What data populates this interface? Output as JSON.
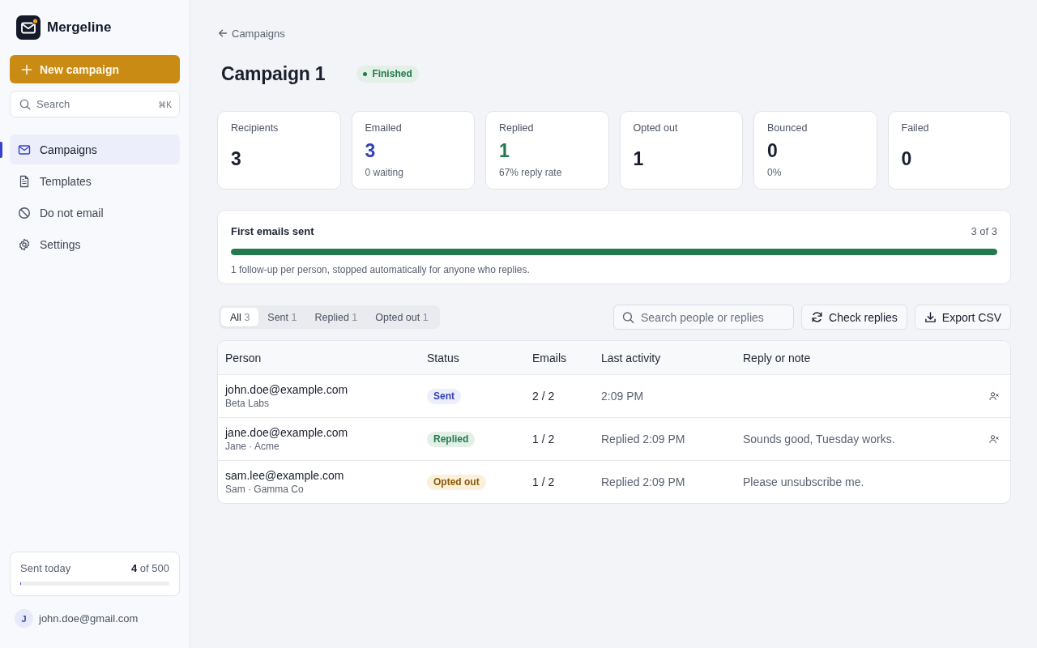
{
  "sidebar": {
    "brand": "Mergeline",
    "new_button": "New campaign",
    "search": {
      "placeholder": "Search",
      "shortcut": "⌘K"
    },
    "nav": [
      {
        "label": "Campaigns",
        "selected": true
      },
      {
        "label": "Templates",
        "selected": false
      },
      {
        "label": "Do not email",
        "selected": false
      },
      {
        "label": "Settings",
        "selected": false
      }
    ],
    "usage": {
      "label": "Sent today",
      "value": "**4** of 500",
      "level": 0.008
    },
    "user": {
      "initial": "J",
      "email": "john.doe@gmail.com"
    }
  },
  "header": {
    "back_link": "Campaigns",
    "title": "Campaign 1",
    "status": "Finished"
  },
  "stats": [
    {
      "label": "Recipients",
      "value": "3",
      "color": "#1a1f2e"
    },
    {
      "label": "Emailed",
      "value": "3",
      "note": "0 waiting",
      "color": "#3641b7"
    },
    {
      "label": "Replied",
      "value": "1",
      "note": "67% reply rate",
      "color": "#237a4c"
    },
    {
      "label": "Opted out",
      "value": "1",
      "color": "#1a1f2e"
    },
    {
      "label": "Bounced",
      "value": "0",
      "note": "0%",
      "color": "#1a1f2e"
    },
    {
      "label": "Failed",
      "value": "0",
      "color": "#1a1f2e"
    }
  ],
  "progress": {
    "title": "First emails sent",
    "count": "3 of 3",
    "level": 1,
    "note": "1 follow-up per person, stopped automatically for anyone who replies."
  },
  "filters": [
    {
      "label": "All",
      "count": "3",
      "selected": true
    },
    {
      "label": "Sent",
      "count": "1",
      "selected": false
    },
    {
      "label": "Replied",
      "count": "1",
      "selected": false
    },
    {
      "label": "Opted out",
      "count": "1",
      "selected": false
    }
  ],
  "search": {
    "placeholder": "Search people or replies"
  },
  "actions": [
    "Check replies",
    "Export CSV"
  ],
  "table": {
    "columns": [
      "Person",
      "Status",
      "Emails",
      "Last activity",
      "Reply or note"
    ],
    "rows": [
      {
        "email": "john.doe@example.com",
        "detail": "Beta Labs",
        "status": {
          "label": "Sent",
          "kind": "sent"
        },
        "emails": "2 / 2",
        "last_activity": "2:09 PM",
        "block_action": true
      },
      {
        "email": "jane.doe@example.com",
        "detail": "Jane · Acme",
        "status": {
          "label": "Replied",
          "kind": "replied"
        },
        "emails": "1 / 2",
        "last_activity": "Replied 2:09 PM",
        "reply": "Sounds good, Tuesday works.",
        "block_action": true
      },
      {
        "email": "sam.lee@example.com",
        "detail": "Sam · Gamma Co",
        "status": {
          "label": "Opted out",
          "kind": "opted_out"
        },
        "emails": "1 / 2",
        "last_activity": "Replied 2:09 PM",
        "reply": "Please unsubscribe me.",
        "block_action": false
      }
    ]
  }
}
